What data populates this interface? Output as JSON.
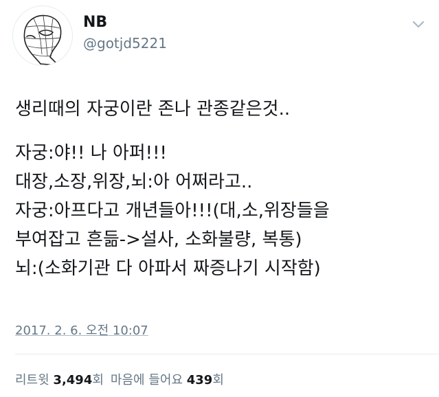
{
  "author": {
    "display_name": "NB",
    "handle": "@gotjd5221",
    "avatar_icon": "spiderman-sketch-avatar"
  },
  "menu_icon": "chevron-down-icon",
  "tweet": {
    "lines": [
      "생리때의 자궁이란 존나 관종같은것..",
      "자궁:야!! 나 아퍼!!!",
      "대장,소장,위장,뇌:아 어쩌라고..",
      "자궁:아프다고 개년들아!!!(대,소,위장들을",
      "부여잡고 흔듦->설사, 소화불량, 복통)",
      "뇌:(소화기관 다 아파서 짜증나기 시작함)"
    ]
  },
  "timestamp": "2017. 2. 6. 오전 10:07",
  "stats": {
    "retweet_label": "리트윗",
    "retweet_count": "3,494",
    "retweet_unit": "회",
    "like_label": "마음에 들어요",
    "like_count": "439",
    "like_unit": "회"
  },
  "colors": {
    "text": "#14171a",
    "secondary": "#657786",
    "divider": "#e6ecf0"
  }
}
